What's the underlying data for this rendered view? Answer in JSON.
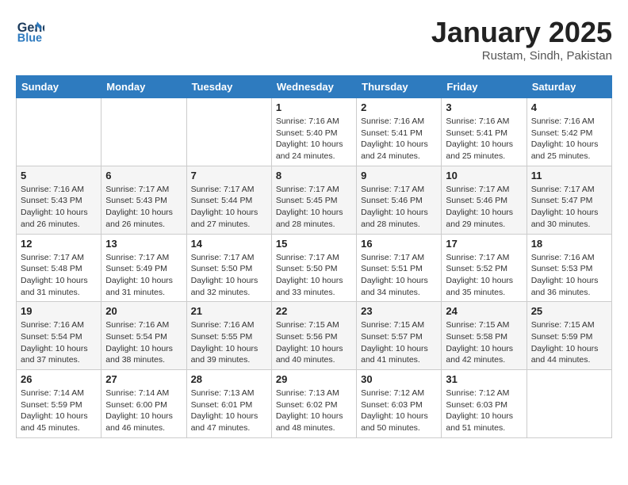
{
  "header": {
    "logo_line1": "General",
    "logo_line2": "Blue",
    "month_title": "January 2025",
    "subtitle": "Rustam, Sindh, Pakistan"
  },
  "weekdays": [
    "Sunday",
    "Monday",
    "Tuesday",
    "Wednesday",
    "Thursday",
    "Friday",
    "Saturday"
  ],
  "weeks": [
    [
      {
        "day": "",
        "info": ""
      },
      {
        "day": "",
        "info": ""
      },
      {
        "day": "",
        "info": ""
      },
      {
        "day": "1",
        "info": "Sunrise: 7:16 AM\nSunset: 5:40 PM\nDaylight: 10 hours\nand 24 minutes."
      },
      {
        "day": "2",
        "info": "Sunrise: 7:16 AM\nSunset: 5:41 PM\nDaylight: 10 hours\nand 24 minutes."
      },
      {
        "day": "3",
        "info": "Sunrise: 7:16 AM\nSunset: 5:41 PM\nDaylight: 10 hours\nand 25 minutes."
      },
      {
        "day": "4",
        "info": "Sunrise: 7:16 AM\nSunset: 5:42 PM\nDaylight: 10 hours\nand 25 minutes."
      }
    ],
    [
      {
        "day": "5",
        "info": "Sunrise: 7:16 AM\nSunset: 5:43 PM\nDaylight: 10 hours\nand 26 minutes."
      },
      {
        "day": "6",
        "info": "Sunrise: 7:17 AM\nSunset: 5:43 PM\nDaylight: 10 hours\nand 26 minutes."
      },
      {
        "day": "7",
        "info": "Sunrise: 7:17 AM\nSunset: 5:44 PM\nDaylight: 10 hours\nand 27 minutes."
      },
      {
        "day": "8",
        "info": "Sunrise: 7:17 AM\nSunset: 5:45 PM\nDaylight: 10 hours\nand 28 minutes."
      },
      {
        "day": "9",
        "info": "Sunrise: 7:17 AM\nSunset: 5:46 PM\nDaylight: 10 hours\nand 28 minutes."
      },
      {
        "day": "10",
        "info": "Sunrise: 7:17 AM\nSunset: 5:46 PM\nDaylight: 10 hours\nand 29 minutes."
      },
      {
        "day": "11",
        "info": "Sunrise: 7:17 AM\nSunset: 5:47 PM\nDaylight: 10 hours\nand 30 minutes."
      }
    ],
    [
      {
        "day": "12",
        "info": "Sunrise: 7:17 AM\nSunset: 5:48 PM\nDaylight: 10 hours\nand 31 minutes."
      },
      {
        "day": "13",
        "info": "Sunrise: 7:17 AM\nSunset: 5:49 PM\nDaylight: 10 hours\nand 31 minutes."
      },
      {
        "day": "14",
        "info": "Sunrise: 7:17 AM\nSunset: 5:50 PM\nDaylight: 10 hours\nand 32 minutes."
      },
      {
        "day": "15",
        "info": "Sunrise: 7:17 AM\nSunset: 5:50 PM\nDaylight: 10 hours\nand 33 minutes."
      },
      {
        "day": "16",
        "info": "Sunrise: 7:17 AM\nSunset: 5:51 PM\nDaylight: 10 hours\nand 34 minutes."
      },
      {
        "day": "17",
        "info": "Sunrise: 7:17 AM\nSunset: 5:52 PM\nDaylight: 10 hours\nand 35 minutes."
      },
      {
        "day": "18",
        "info": "Sunrise: 7:16 AM\nSunset: 5:53 PM\nDaylight: 10 hours\nand 36 minutes."
      }
    ],
    [
      {
        "day": "19",
        "info": "Sunrise: 7:16 AM\nSunset: 5:54 PM\nDaylight: 10 hours\nand 37 minutes."
      },
      {
        "day": "20",
        "info": "Sunrise: 7:16 AM\nSunset: 5:54 PM\nDaylight: 10 hours\nand 38 minutes."
      },
      {
        "day": "21",
        "info": "Sunrise: 7:16 AM\nSunset: 5:55 PM\nDaylight: 10 hours\nand 39 minutes."
      },
      {
        "day": "22",
        "info": "Sunrise: 7:15 AM\nSunset: 5:56 PM\nDaylight: 10 hours\nand 40 minutes."
      },
      {
        "day": "23",
        "info": "Sunrise: 7:15 AM\nSunset: 5:57 PM\nDaylight: 10 hours\nand 41 minutes."
      },
      {
        "day": "24",
        "info": "Sunrise: 7:15 AM\nSunset: 5:58 PM\nDaylight: 10 hours\nand 42 minutes."
      },
      {
        "day": "25",
        "info": "Sunrise: 7:15 AM\nSunset: 5:59 PM\nDaylight: 10 hours\nand 44 minutes."
      }
    ],
    [
      {
        "day": "26",
        "info": "Sunrise: 7:14 AM\nSunset: 5:59 PM\nDaylight: 10 hours\nand 45 minutes."
      },
      {
        "day": "27",
        "info": "Sunrise: 7:14 AM\nSunset: 6:00 PM\nDaylight: 10 hours\nand 46 minutes."
      },
      {
        "day": "28",
        "info": "Sunrise: 7:13 AM\nSunset: 6:01 PM\nDaylight: 10 hours\nand 47 minutes."
      },
      {
        "day": "29",
        "info": "Sunrise: 7:13 AM\nSunset: 6:02 PM\nDaylight: 10 hours\nand 48 minutes."
      },
      {
        "day": "30",
        "info": "Sunrise: 7:12 AM\nSunset: 6:03 PM\nDaylight: 10 hours\nand 50 minutes."
      },
      {
        "day": "31",
        "info": "Sunrise: 7:12 AM\nSunset: 6:03 PM\nDaylight: 10 hours\nand 51 minutes."
      },
      {
        "day": "",
        "info": ""
      }
    ]
  ]
}
